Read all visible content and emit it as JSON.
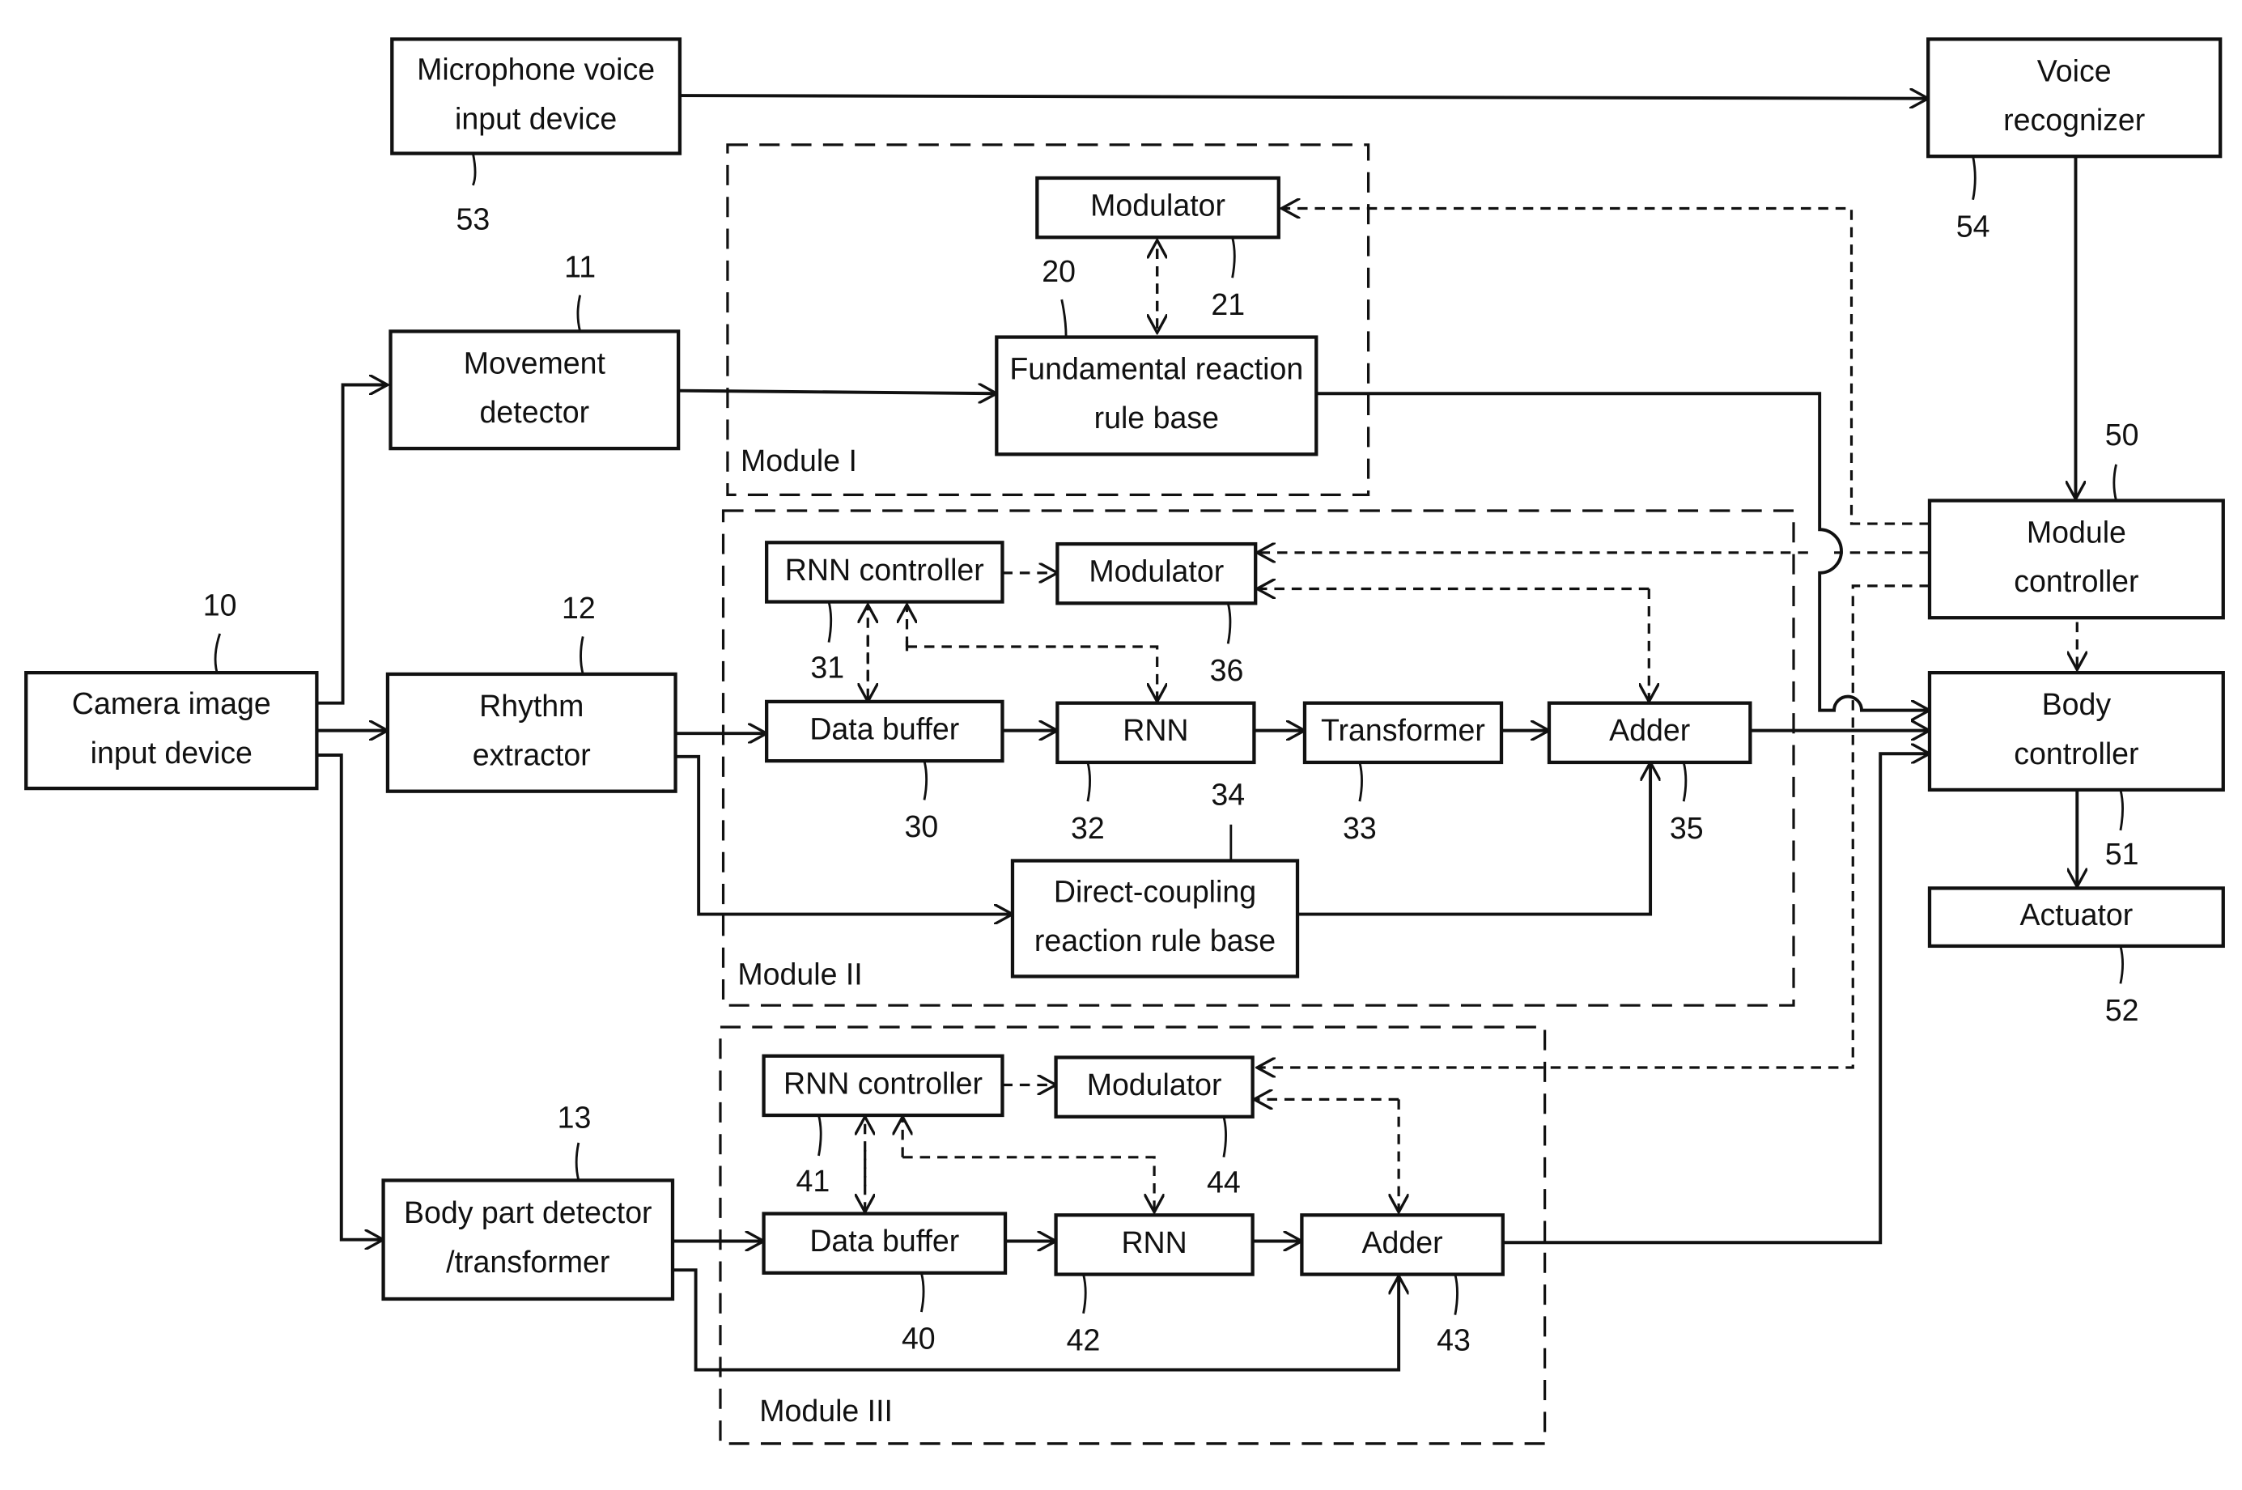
{
  "figure": {
    "blocks": [
      {
        "id": "mic",
        "lines": [
          "Microphone voice",
          "input device"
        ],
        "ref": "53"
      },
      {
        "id": "voice",
        "lines": [
          "Voice",
          "recognizer"
        ],
        "ref": "54"
      },
      {
        "id": "move",
        "lines": [
          "Movement",
          "detector"
        ],
        "ref": "11"
      },
      {
        "id": "mod1",
        "lines": [
          "Modulator"
        ],
        "ref": "21"
      },
      {
        "id": "frrb",
        "lines": [
          "Fundamental reaction",
          "rule base"
        ],
        "ref": "20"
      },
      {
        "id": "camera",
        "lines": [
          "Camera image",
          "input device"
        ],
        "ref": "10"
      },
      {
        "id": "rhythm",
        "lines": [
          "Rhythm",
          "extractor"
        ],
        "ref": "12"
      },
      {
        "id": "rnnc2",
        "lines": [
          "RNN controller"
        ],
        "ref": "31"
      },
      {
        "id": "mod2",
        "lines": [
          "Modulator"
        ],
        "ref": "36"
      },
      {
        "id": "buf2",
        "lines": [
          "Data buffer"
        ],
        "ref": "30"
      },
      {
        "id": "rnn2",
        "lines": [
          "RNN"
        ],
        "ref": "32"
      },
      {
        "id": "trans",
        "lines": [
          "Transformer"
        ],
        "ref": "33"
      },
      {
        "id": "add2",
        "lines": [
          "Adder"
        ],
        "ref": "35"
      },
      {
        "id": "dcrrb",
        "lines": [
          "Direct-coupling",
          "reaction rule base"
        ],
        "ref": "34"
      },
      {
        "id": "modctl",
        "lines": [
          "Module",
          "controller"
        ],
        "ref": "50"
      },
      {
        "id": "bodyctl",
        "lines": [
          "Body",
          "controller"
        ],
        "ref": "51"
      },
      {
        "id": "actuator",
        "lines": [
          "Actuator"
        ],
        "ref": "52"
      },
      {
        "id": "bodypart",
        "lines": [
          "Body part detector",
          "/transformer"
        ],
        "ref": "13"
      },
      {
        "id": "rnnc3",
        "lines": [
          "RNN controller"
        ],
        "ref": "41"
      },
      {
        "id": "mod3",
        "lines": [
          "Modulator"
        ],
        "ref": "44"
      },
      {
        "id": "buf3",
        "lines": [
          "Data buffer"
        ],
        "ref": "40"
      },
      {
        "id": "rnn3",
        "lines": [
          "RNN"
        ],
        "ref": "42"
      },
      {
        "id": "add3",
        "lines": [
          "Adder"
        ],
        "ref": "43"
      }
    ],
    "modules": [
      {
        "id": "m1",
        "label": "Module I"
      },
      {
        "id": "m2",
        "label": "Module II"
      },
      {
        "id": "m3",
        "label": "Module III"
      }
    ]
  }
}
